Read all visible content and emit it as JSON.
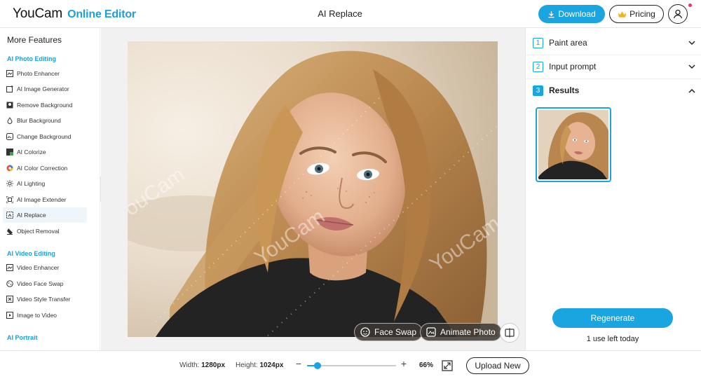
{
  "header": {
    "brand": "YouCam",
    "brand_sub": "Online Editor",
    "page_title": "AI Replace",
    "download_label": "Download",
    "pricing_label": "Pricing"
  },
  "sidebar": {
    "title": "More Features",
    "sections": [
      {
        "label": "AI Photo Editing"
      },
      {
        "label": "AI Video Editing"
      },
      {
        "label": "AI Portrait"
      }
    ],
    "photo_items": [
      {
        "label": "Photo Enhancer",
        "icon": "photo-enhancer-icon"
      },
      {
        "label": "AI Image Generator",
        "icon": "ai-image-generator-icon"
      },
      {
        "label": "Remove Background",
        "icon": "remove-background-icon"
      },
      {
        "label": "Blur Background",
        "icon": "blur-background-icon"
      },
      {
        "label": "Change Background",
        "icon": "change-background-icon"
      },
      {
        "label": "AI Colorize",
        "icon": "colorize-icon"
      },
      {
        "label": "AI Color Correction",
        "icon": "color-correction-icon"
      },
      {
        "label": "AI Lighting",
        "icon": "lighting-icon"
      },
      {
        "label": "AI Image Extender",
        "icon": "image-extender-icon"
      },
      {
        "label": "AI Replace",
        "icon": "replace-icon",
        "active": true
      },
      {
        "label": "Object Removal",
        "icon": "object-removal-icon"
      }
    ],
    "video_items": [
      {
        "label": "Video Enhancer",
        "icon": "video-enhancer-icon"
      },
      {
        "label": "Video Face Swap",
        "icon": "video-face-swap-icon"
      },
      {
        "label": "Video Style Transfer",
        "icon": "video-style-transfer-icon"
      },
      {
        "label": "Image to Video",
        "icon": "image-to-video-icon"
      }
    ]
  },
  "canvas": {
    "watermark": "YouCam",
    "face_swap_label": "Face Swap",
    "animate_photo_label": "Animate Photo"
  },
  "panel": {
    "steps": [
      {
        "num": "1",
        "label": "Paint area",
        "expanded": false
      },
      {
        "num": "2",
        "label": "Input prompt",
        "expanded": false
      },
      {
        "num": "3",
        "label": "Results",
        "expanded": true
      }
    ],
    "regenerate_label": "Regenerate",
    "uses_left": "1 use left today"
  },
  "bottom": {
    "width_label": "Width:",
    "width_value": "1280px",
    "height_label": "Height:",
    "height_value": "1024px",
    "zoom_minus": "−",
    "zoom_plus": "+",
    "zoom_value": "66%",
    "zoom_fraction": 0.12,
    "upload_label": "Upload New"
  },
  "colors": {
    "accent": "#1aa5e0",
    "section_label": "#1ba0d8",
    "notification_dot": "#e8317a"
  }
}
